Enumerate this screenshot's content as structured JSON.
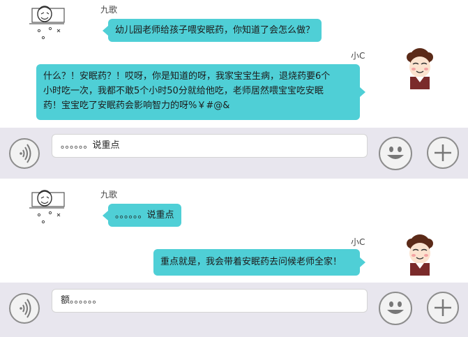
{
  "panels": [
    {
      "chat": {
        "incoming": {
          "sender": "九歌",
          "text": "幼儿园老师给孩子喂安眠药，你知道了会怎么做？"
        },
        "outgoing": {
          "sender": "小C",
          "lines": [
            "什么？！安眠药？！哎呀，你是知道的呀，我家宝宝生病，退烧药要6个",
            "小时吃一次，我都不敢5个小时50分就给他吃，老师居然喂宝宝吃安眠",
            "药！宝宝吃了安眠药会影响智力的呀%￥#@&"
          ]
        }
      },
      "input_bar": {
        "text": "。。。。。。说重点"
      }
    },
    {
      "chat": {
        "incoming": {
          "sender": "九歌",
          "text": "。。。。。。说重点"
        },
        "outgoing": {
          "sender": "小C",
          "text": "重点就是，我会带着安眠药去问候老师全家！"
        }
      },
      "input_bar": {
        "text": "额。。。。。。"
      }
    }
  ],
  "icons": {
    "voice": "voice-icon",
    "emoji": "smiley-icon",
    "add": "plus-icon"
  },
  "colors": {
    "bubble": "#4fcfd6",
    "bar": "#e8e6ee"
  }
}
